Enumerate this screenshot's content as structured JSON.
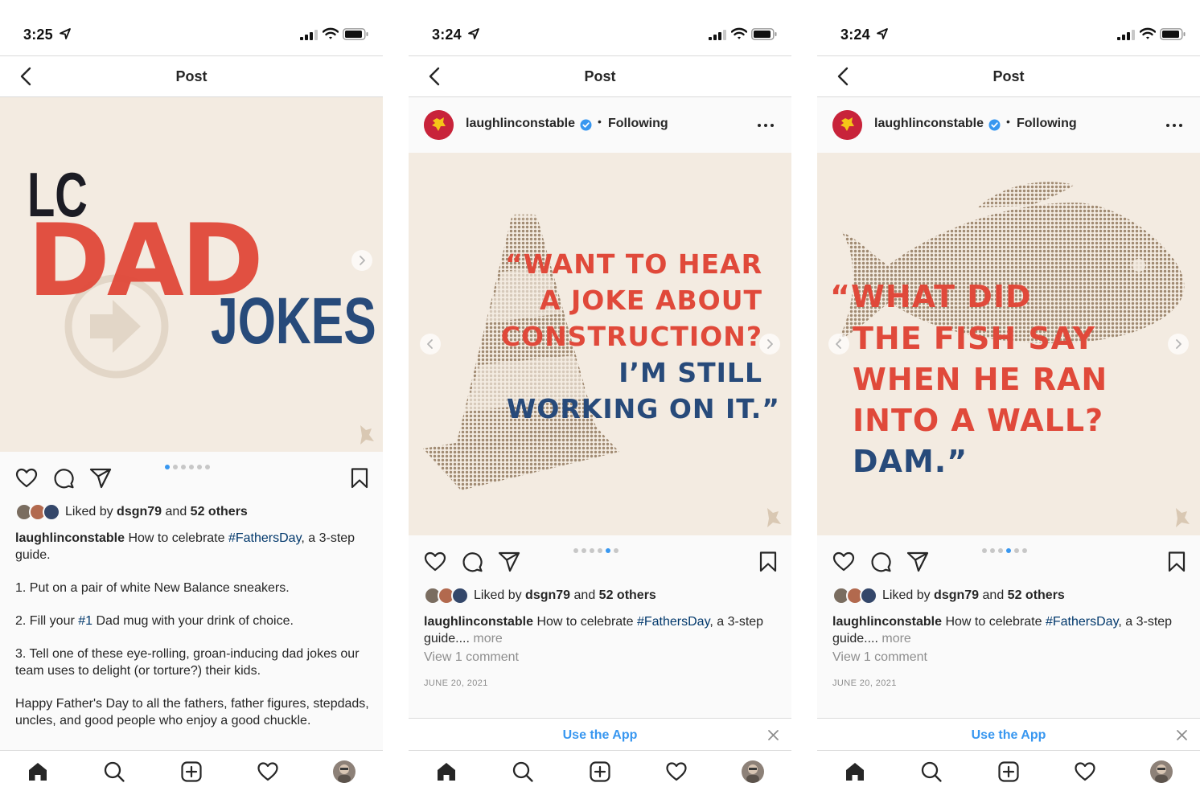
{
  "colors": {
    "accent_blue": "#3897f0",
    "hashtag": "#00376b",
    "brand_red": "#e0493a",
    "brand_navy": "#274a7a",
    "media_bg": "#f3ebe1"
  },
  "screens": [
    {
      "status": {
        "time": "3:25"
      },
      "nav": {
        "title": "Post"
      },
      "slide": {
        "lc": "LC",
        "dad": "DAD",
        "jokes": "JOKES"
      },
      "carousel": {
        "total": 6,
        "active_index": 0
      },
      "likes": {
        "prefix": "Liked by",
        "user": "dsgn79",
        "mid": "and",
        "others": "52 others"
      },
      "caption": {
        "username": "laughlinconstable",
        "t1": " How to celebrate ",
        "hashtag": "#FathersDay",
        "t2": ", a 3-step guide.",
        "step1": "1. Put on a pair of white New Balance sneakers.",
        "step2_a": "2. Fill your ",
        "step2_tag": "#1",
        "step2_b": " Dad mug with your drink of choice.",
        "step3": "3. Tell one of these eye-rolling, groan-inducing dad jokes our team uses to delight (or torture?) their kids.",
        "closing": "Happy Father's Day to all the fathers, father figures, stepdads, uncles, and good people who enjoy a good chuckle."
      }
    },
    {
      "status": {
        "time": "3:24"
      },
      "nav": {
        "title": "Post"
      },
      "header": {
        "username": "laughlinconstable",
        "separator": "•",
        "following": "Following"
      },
      "slide": {
        "red_lines": [
          "“WANT TO HEAR",
          "A JOKE ABOUT",
          "CONSTRUCTION?"
        ],
        "blue_lines": [
          "I’M STILL",
          "WORKING ON IT.”"
        ]
      },
      "carousel": {
        "total": 6,
        "active_index": 4
      },
      "likes": {
        "prefix": "Liked by",
        "user": "dsgn79",
        "mid": "and",
        "others": "52 others"
      },
      "caption": {
        "username": "laughlinconstable",
        "t1": " How to celebrate ",
        "hashtag": "#FathersDay",
        "t2": ", a 3-step guide.... ",
        "more": "more"
      },
      "view_comments": "View 1 comment",
      "date": "JUNE 20, 2021",
      "use_app": "Use the App"
    },
    {
      "status": {
        "time": "3:24"
      },
      "nav": {
        "title": "Post"
      },
      "header": {
        "username": "laughlinconstable",
        "separator": "•",
        "following": "Following"
      },
      "slide": {
        "red_lines": [
          "“WHAT DID",
          "THE FISH SAY",
          "WHEN HE RAN",
          "INTO A WALL?"
        ],
        "blue_lines": [
          "DAM.”"
        ]
      },
      "carousel": {
        "total": 6,
        "active_index": 3
      },
      "likes": {
        "prefix": "Liked by",
        "user": "dsgn79",
        "mid": "and",
        "others": "52 others"
      },
      "caption": {
        "username": "laughlinconstable",
        "t1": " How to celebrate ",
        "hashtag": "#FathersDay",
        "t2": ", a 3-step guide.... ",
        "more": "more"
      },
      "view_comments": "View 1 comment",
      "date": "JUNE 20, 2021",
      "use_app": "Use the App"
    }
  ]
}
